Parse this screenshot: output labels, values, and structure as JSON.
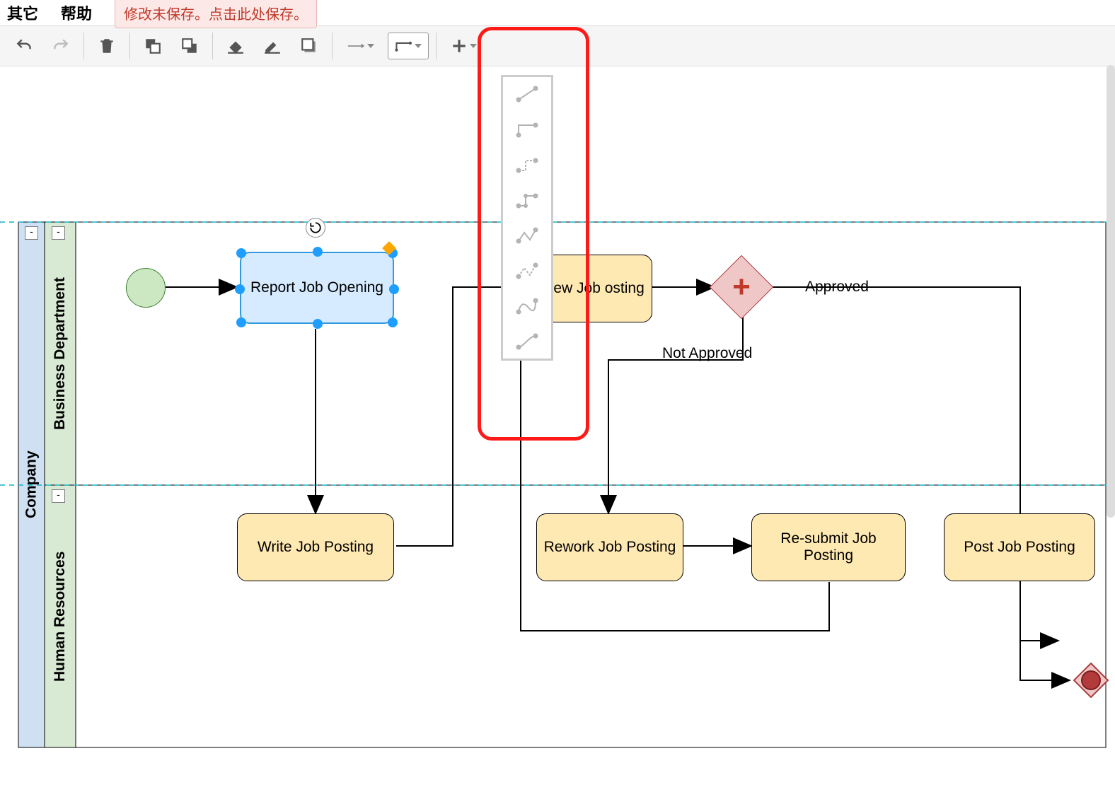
{
  "menu": {
    "other": "其它",
    "help": "帮助"
  },
  "unsaved_msg": "修改未保存。点击此处保存。",
  "toolbar_icons": {
    "undo": "undo-icon",
    "redo": "redo-icon",
    "delete": "delete-icon",
    "to_front": "to-front-icon",
    "to_back": "to-back-icon",
    "fill": "fill-icon",
    "line": "line-color-icon",
    "shadow": "shadow-icon",
    "arrow_style": "arrow-style-icon",
    "waypoint_style": "waypoint-style-icon",
    "add": "add-icon"
  },
  "lanes": {
    "pool": "Company",
    "lane1": "Business Department",
    "lane2": "Human Resources"
  },
  "tasks": {
    "report_job": "Report Job Opening",
    "review_job": "view Job osting",
    "write_job": "Write Job Posting",
    "rework_job": "Rework Job Posting",
    "resubmit_job": "Re-submit Job Posting",
    "post_job": "Post Job Posting"
  },
  "edge_labels": {
    "approved": "Approved",
    "not_approved": "Not Approved"
  },
  "waypoint_options": [
    "straight",
    "orthogonal",
    "orthogonal-alt",
    "isometric",
    "zigzag",
    "dashed-zigzag",
    "curved",
    "smooth"
  ],
  "collapse": "-"
}
